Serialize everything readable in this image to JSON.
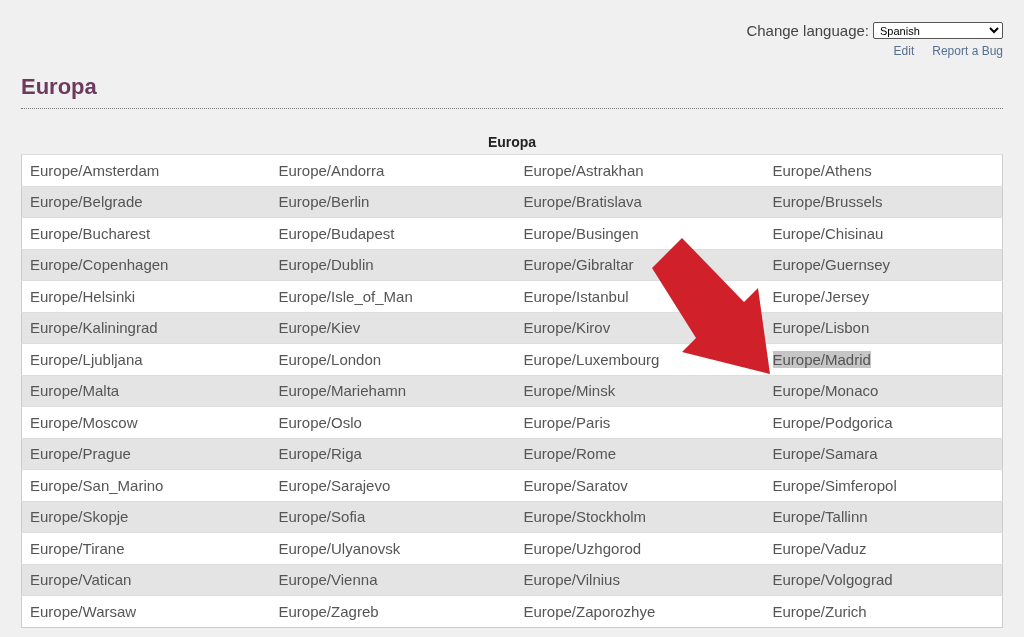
{
  "language": {
    "label": "Change language:",
    "value": "Spanish"
  },
  "links": [
    "Edit",
    "Report a Bug"
  ],
  "heading": "Europa",
  "table": {
    "caption": "Europa",
    "rows": [
      [
        {
          "text": "Europe/Amsterdam",
          "selected": false
        },
        {
          "text": "Europe/Andorra",
          "selected": false
        },
        {
          "text": "Europe/Astrakhan",
          "selected": false
        },
        {
          "text": "Europe/Athens",
          "selected": false
        }
      ],
      [
        {
          "text": "Europe/Belgrade",
          "selected": false
        },
        {
          "text": "Europe/Berlin",
          "selected": false
        },
        {
          "text": "Europe/Bratislava",
          "selected": false
        },
        {
          "text": "Europe/Brussels",
          "selected": false
        }
      ],
      [
        {
          "text": "Europe/Bucharest",
          "selected": false
        },
        {
          "text": "Europe/Budapest",
          "selected": false
        },
        {
          "text": "Europe/Busingen",
          "selected": false
        },
        {
          "text": "Europe/Chisinau",
          "selected": false
        }
      ],
      [
        {
          "text": "Europe/Copenhagen",
          "selected": false
        },
        {
          "text": "Europe/Dublin",
          "selected": false
        },
        {
          "text": "Europe/Gibraltar",
          "selected": false
        },
        {
          "text": "Europe/Guernsey",
          "selected": false
        }
      ],
      [
        {
          "text": "Europe/Helsinki",
          "selected": false
        },
        {
          "text": "Europe/Isle_of_Man",
          "selected": false
        },
        {
          "text": "Europe/Istanbul",
          "selected": false
        },
        {
          "text": "Europe/Jersey",
          "selected": false
        }
      ],
      [
        {
          "text": "Europe/Kaliningrad",
          "selected": false
        },
        {
          "text": "Europe/Kiev",
          "selected": false
        },
        {
          "text": "Europe/Kirov",
          "selected": false
        },
        {
          "text": "Europe/Lisbon",
          "selected": false
        }
      ],
      [
        {
          "text": "Europe/Ljubljana",
          "selected": false
        },
        {
          "text": "Europe/London",
          "selected": false
        },
        {
          "text": "Europe/Luxembourg",
          "selected": false
        },
        {
          "text": "Europe/Madrid",
          "selected": true
        }
      ],
      [
        {
          "text": "Europe/Malta",
          "selected": false
        },
        {
          "text": "Europe/Mariehamn",
          "selected": false
        },
        {
          "text": "Europe/Minsk",
          "selected": false
        },
        {
          "text": "Europe/Monaco",
          "selected": false
        }
      ],
      [
        {
          "text": "Europe/Moscow",
          "selected": false
        },
        {
          "text": "Europe/Oslo",
          "selected": false
        },
        {
          "text": "Europe/Paris",
          "selected": false
        },
        {
          "text": "Europe/Podgorica",
          "selected": false
        }
      ],
      [
        {
          "text": "Europe/Prague",
          "selected": false
        },
        {
          "text": "Europe/Riga",
          "selected": false
        },
        {
          "text": "Europe/Rome",
          "selected": false
        },
        {
          "text": "Europe/Samara",
          "selected": false
        }
      ],
      [
        {
          "text": "Europe/San_Marino",
          "selected": false
        },
        {
          "text": "Europe/Sarajevo",
          "selected": false
        },
        {
          "text": "Europe/Saratov",
          "selected": false
        },
        {
          "text": "Europe/Simferopol",
          "selected": false
        }
      ],
      [
        {
          "text": "Europe/Skopje",
          "selected": false
        },
        {
          "text": "Europe/Sofia",
          "selected": false
        },
        {
          "text": "Europe/Stockholm",
          "selected": false
        },
        {
          "text": "Europe/Tallinn",
          "selected": false
        }
      ],
      [
        {
          "text": "Europe/Tirane",
          "selected": false
        },
        {
          "text": "Europe/Ulyanovsk",
          "selected": false
        },
        {
          "text": "Europe/Uzhgorod",
          "selected": false
        },
        {
          "text": "Europe/Vaduz",
          "selected": false
        }
      ],
      [
        {
          "text": "Europe/Vatican",
          "selected": false
        },
        {
          "text": "Europe/Vienna",
          "selected": false
        },
        {
          "text": "Europe/Vilnius",
          "selected": false
        },
        {
          "text": "Europe/Volgograd",
          "selected": false
        }
      ],
      [
        {
          "text": "Europe/Warsaw",
          "selected": false
        },
        {
          "text": "Europe/Zagreb",
          "selected": false
        },
        {
          "text": "Europe/Zaporozhye",
          "selected": false
        },
        {
          "text": "Europe/Zurich",
          "selected": false
        }
      ]
    ]
  }
}
